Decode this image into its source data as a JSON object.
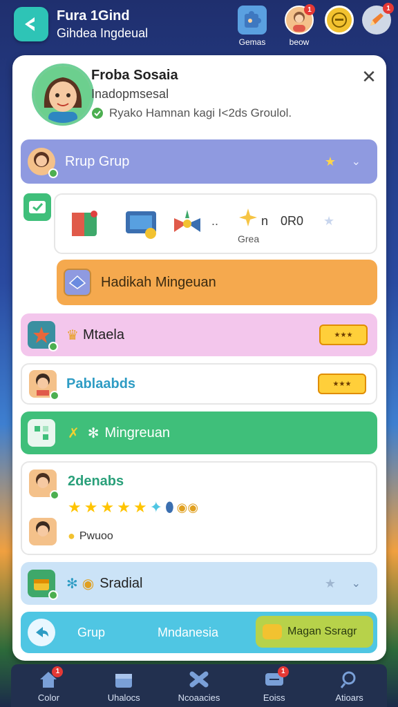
{
  "header": {
    "title": "Fura 1Gind",
    "subtitle": "Gihdea Ingdeual",
    "buttons": [
      {
        "label": "Gemas",
        "icon": "puzzle-icon",
        "badge": ""
      },
      {
        "label": "beow",
        "icon": "avatar-icon",
        "badge": "1"
      },
      {
        "label": "",
        "icon": "coin-icon",
        "badge": ""
      },
      {
        "label": "",
        "icon": "pencil-icon",
        "badge": "1"
      }
    ]
  },
  "profile": {
    "name": "Froba Sosaia",
    "status": "Inadopmsesal",
    "description": "Ryako Hamnan kagi I<2ds Groulol."
  },
  "rows": {
    "group_title": "Rrup Grup",
    "gift_label": "Grea",
    "gift_count_n": "n",
    "gift_count_val": "0R0",
    "gift_dots": "..",
    "gift_button": "Hadikah Mingeuan",
    "mtaela": "Mtaela",
    "pabla": "Pablaabds",
    "mingreuan": "Mingreuan",
    "dzenabs": "2denabs",
    "dzenabs_sub": "Pwuoo",
    "stars_count": 5,
    "sradial": "Sradial"
  },
  "bottom_strip": {
    "left": "Grup",
    "middle": "Mndanesia",
    "button": "Magan Ssragr"
  },
  "nav": [
    {
      "label": "Color",
      "icon": "home-icon",
      "badge": "1"
    },
    {
      "label": "Uhalocs",
      "icon": "box-icon",
      "badge": ""
    },
    {
      "label": "Ncoaacies",
      "icon": "puzzle-piece-icon",
      "badge": ""
    },
    {
      "label": "Eoiss",
      "icon": "message-icon",
      "badge": "1"
    },
    {
      "label": "Atioars",
      "icon": "search-icon",
      "badge": ""
    }
  ],
  "colors": {
    "group_row": "#8f9ae0",
    "gift_button": "#f5a94e",
    "mtaela_row": "#f3c6ec",
    "mingreuan_row": "#3fbf7a",
    "sradial_row": "#cbe3f7",
    "bottom_strip": "#4fc6e3",
    "bottom_button": "#b7d24a"
  }
}
